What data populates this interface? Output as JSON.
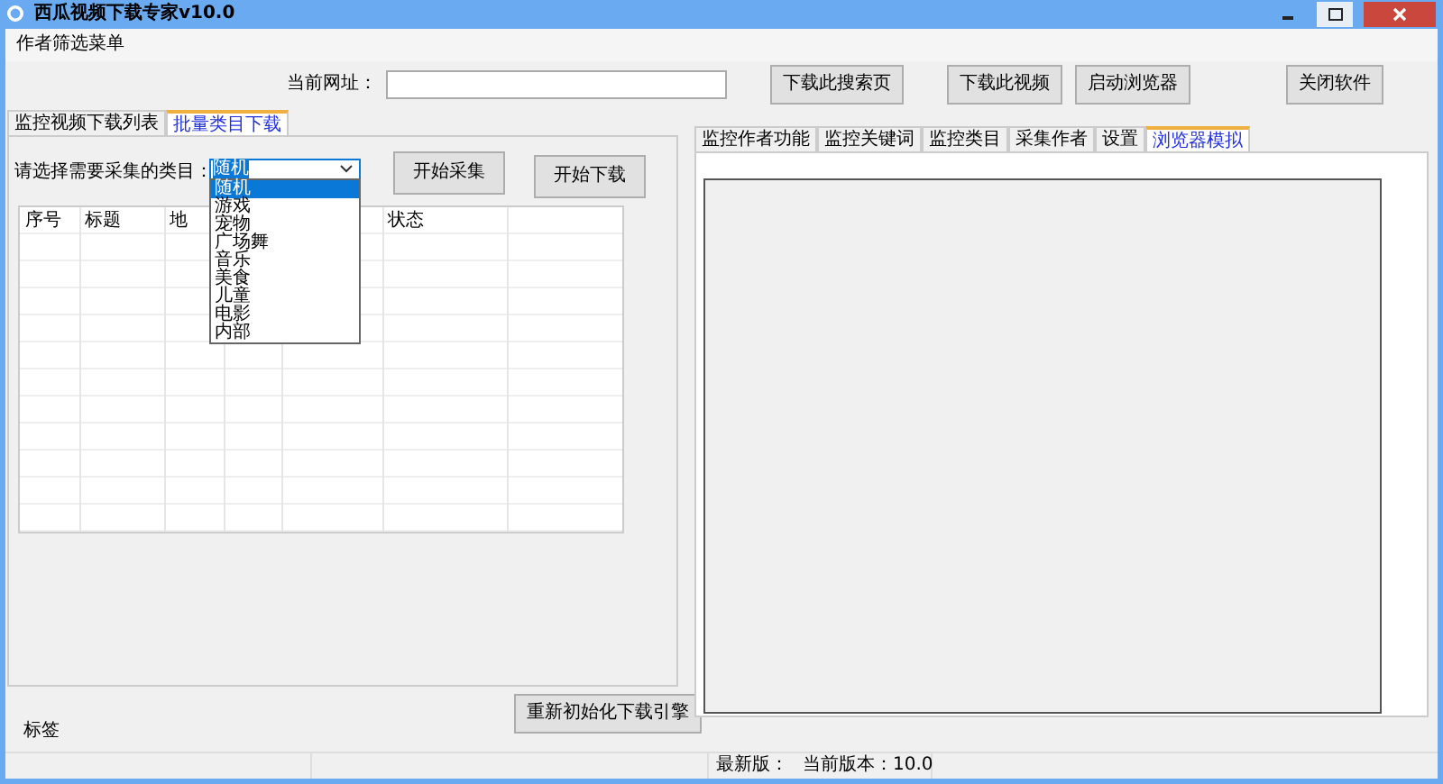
{
  "window": {
    "title": "西瓜视频下载专家v10.0"
  },
  "menu": [
    "作者筛选菜单"
  ],
  "url_bar": {
    "label": "当前网址："
  },
  "toolbar_buttons": [
    "下载此搜索页",
    "下载此视频",
    "启动浏览器",
    "关闭软件"
  ],
  "left_tabs": [
    {
      "label": "监控视频下载列表",
      "selected": false
    },
    {
      "label": "批量类目下载",
      "selected": true
    }
  ],
  "category_picker": {
    "label": "请选择需要采集的类目：",
    "value": "随机",
    "expanded": true,
    "options": [
      {
        "label": "随机",
        "selected": true
      },
      {
        "label": "游戏",
        "selected": false
      },
      {
        "label": "宠物",
        "selected": false
      },
      {
        "label": "广场舞",
        "selected": false
      },
      {
        "label": "音乐",
        "selected": false
      },
      {
        "label": "美食",
        "selected": false
      },
      {
        "label": "儿童",
        "selected": false
      },
      {
        "label": "电影",
        "selected": false
      },
      {
        "label": "内部",
        "selected": false
      }
    ]
  },
  "action_buttons": [
    "开始采集",
    "开始下载"
  ],
  "table": {
    "columns": [
      "序号",
      "标题",
      "地",
      "状态"
    ]
  },
  "bottom_label": "标签",
  "reinit_button": "重新初始化下载引擎",
  "right_tabs": [
    {
      "label": "监控作者功能",
      "selected": false
    },
    {
      "label": "监控关键词",
      "selected": false
    },
    {
      "label": "监控类目",
      "selected": false
    },
    {
      "label": "采集作者",
      "selected": false
    },
    {
      "label": "设置",
      "selected": false
    },
    {
      "label": "浏览器模拟",
      "selected": true
    }
  ],
  "status_bar": [
    "最新版：",
    "当前版本：10.0"
  ]
}
